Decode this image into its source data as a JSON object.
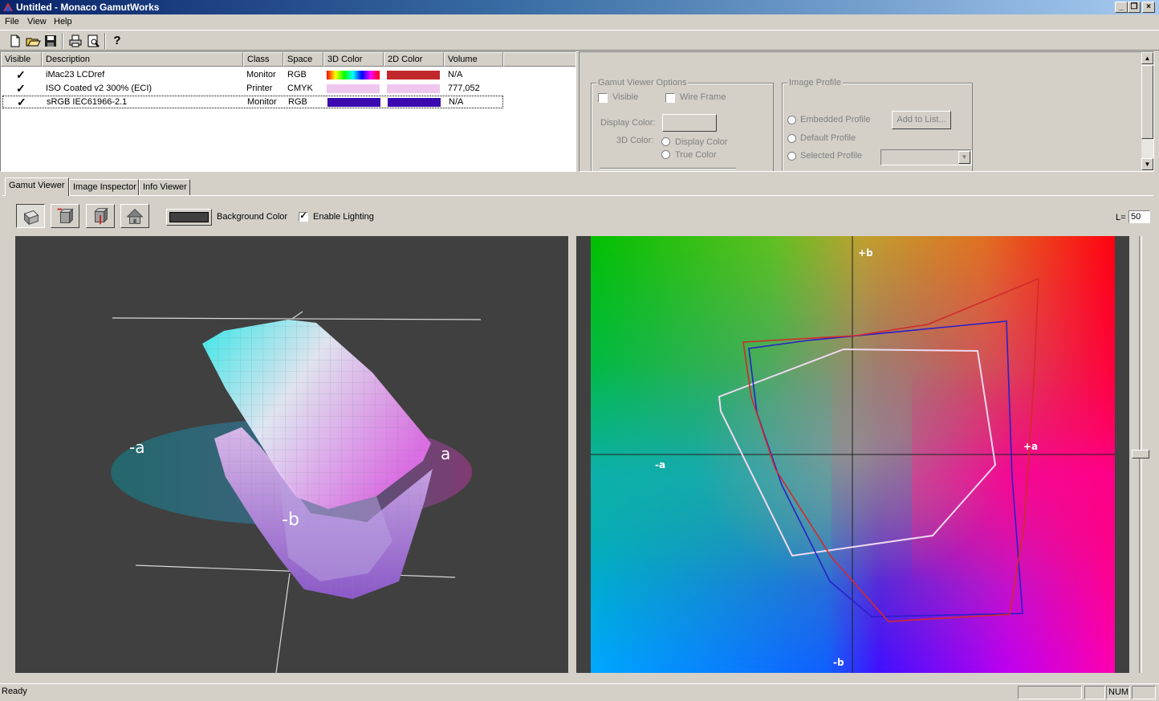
{
  "window": {
    "title": "Untitled - Monaco GamutWorks",
    "controls": {
      "minimize": "_",
      "restore": "❐",
      "close": "×"
    }
  },
  "menu": [
    "File",
    "View",
    "Help"
  ],
  "toolbar": {
    "buttons": [
      "new-icon",
      "open-icon",
      "save-icon",
      "print-icon",
      "print-preview-icon",
      "help-icon"
    ],
    "help_glyph": "?"
  },
  "profiles": {
    "columns": [
      "Visible",
      "Description",
      "Class",
      "Space",
      "3D Color",
      "2D Color",
      "Volume"
    ],
    "check_glyph": "✓",
    "rows": [
      {
        "visible": true,
        "description": "iMac23 LCDref",
        "class": "Monitor",
        "space": "RGB",
        "color3d": "rainbow",
        "color2d": "#c0282c",
        "volume": "N/A"
      },
      {
        "visible": true,
        "description": "ISO Coated v2 300% (ECI)",
        "class": "Printer",
        "space": "CMYK",
        "color3d": "#eec6ee",
        "color2d": "#eec6ee",
        "volume": "777,052"
      },
      {
        "visible": true,
        "description": "sRGB IEC61966-2.1",
        "class": "Monitor",
        "space": "RGB",
        "color3d": "#3a0ab0",
        "color2d": "#3a0ab0",
        "volume": "N/A"
      }
    ]
  },
  "gamut_options": {
    "title": "Gamut Viewer Options",
    "visible_label": "Visible",
    "wireframe_label": "Wire Frame",
    "display_color_label": "Display Color:",
    "color3d_label": "3D Color:",
    "radio_display_color": "Display Color",
    "radio_true_color": "True Color"
  },
  "image_profile": {
    "title": "Image Profile",
    "embedded": "Embedded Profile",
    "default": "Default Profile",
    "selected": "Selected Profile",
    "add_button": "Add to List...",
    "dropdown_glyph": "▼"
  },
  "scrollbar": {
    "up": "▲",
    "down": "▼"
  },
  "tabs": [
    "Gamut Viewer",
    "Image Inspector",
    "Info Viewer"
  ],
  "viewer": {
    "buttons": [
      "perspective-view-icon",
      "rotate-view-icon",
      "reset-view-icon",
      "home-view-icon"
    ],
    "background_color_label": "Background Color",
    "background_color": "#404040",
    "enable_lighting_label": "Enable Lighting",
    "enable_lighting": true,
    "l_label": "L=",
    "l_value": "50"
  },
  "view3d": {
    "axis_labels": {
      "minus_a": "-a",
      "plus_a": "a",
      "minus_b": "-b"
    }
  },
  "view2d": {
    "axis_labels": {
      "plus_b": "+b",
      "minus_b": "-b",
      "plus_a": "+a",
      "minus_a": "-a"
    },
    "colors": {
      "imac": "#d22a2a",
      "srgb": "#2a1fc8",
      "iso": "#f0d8f0"
    }
  },
  "status": {
    "text": "Ready",
    "num": "NUM"
  }
}
